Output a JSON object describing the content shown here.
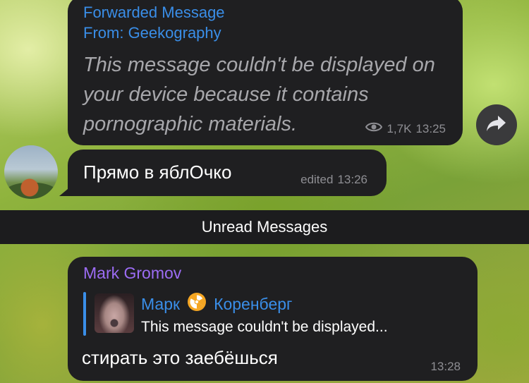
{
  "messages": {
    "forwarded": {
      "label": "Forwarded Message",
      "from_prefix": "From: ",
      "from_name": "Geekography",
      "text": "This message couldn't be displayed on your device because it contains pornographic materials.",
      "views": "1,7K",
      "time": "13:25",
      "icons": {
        "views": "eye-icon",
        "share": "share-arrow-icon"
      }
    },
    "reply_own": {
      "text": "Прямо в яблОчко",
      "status": "edited",
      "time": "13:26"
    },
    "unread_separator": "Unread Messages",
    "mark": {
      "sender": "Mark Gromov",
      "quote": {
        "name_first": "Марк",
        "name_last": "Коренберг",
        "emoji_icon": "radioactive-icon",
        "text": "This message couldn't be displayed..."
      },
      "text": "стирать это заебёшься",
      "time": "13:28"
    }
  },
  "colors": {
    "bubble": "#1f1f21",
    "link_blue": "#3a8ee8",
    "sender_purple": "#9c6cf4",
    "meta_gray": "#8e8e93"
  }
}
